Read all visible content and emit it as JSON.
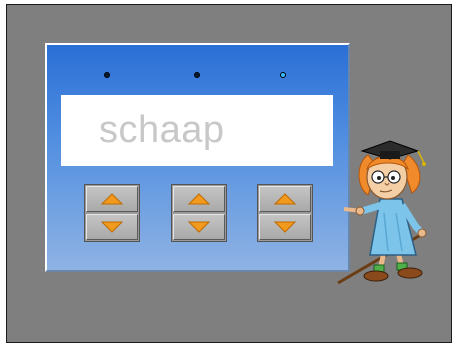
{
  "display": {
    "word": "schaap"
  },
  "indicators": [
    {
      "state": "off",
      "color": "#0a1a33"
    },
    {
      "state": "off",
      "color": "#0a1a33"
    },
    {
      "state": "on",
      "color": "#33bbff"
    }
  ],
  "steppers": [
    {
      "up_icon": "arrow-up-icon",
      "down_icon": "arrow-down-icon"
    },
    {
      "up_icon": "arrow-up-icon",
      "down_icon": "arrow-down-icon"
    },
    {
      "up_icon": "arrow-up-icon",
      "down_icon": "arrow-down-icon"
    }
  ],
  "colors": {
    "stage_bg": "#7f7f7f",
    "panel_top": "#2a6fd6",
    "panel_bottom": "#8fb3e4",
    "arrow": "#f29a1d",
    "word_text": "#c8c8c8"
  },
  "mascot": {
    "icon": "professor-girl-icon"
  }
}
